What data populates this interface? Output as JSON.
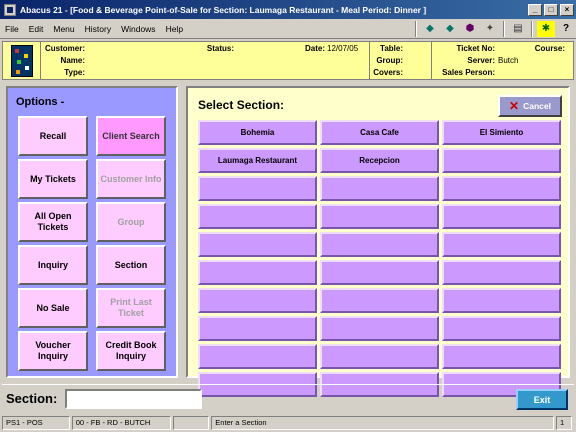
{
  "window": {
    "title": "Abacus 21 - [Food & Beverage Point-of-Sale for Section: Laumaga Restaurant - Meal Period: Dinner ]"
  },
  "menu": [
    "File",
    "Edit",
    "Menu",
    "History",
    "Windows",
    "Help"
  ],
  "toolbar_icons": [
    "arrow-left-icon",
    "arrow-right-icon",
    "gem-icon",
    "run-icon",
    "calculator-icon",
    "exit-person-icon",
    "help-icon"
  ],
  "ticket_info": {
    "customer_label": "Customer:",
    "name_label": "Name:",
    "type_label": "Type:",
    "status_label": "Status:",
    "date_label": "Date:",
    "date_value": "12/07/05",
    "table_label": "Table:",
    "group_label": "Group:",
    "covers_label": "Covers:",
    "ticket_no_label": "Ticket No:",
    "course_label": "Course:",
    "server_label": "Server:",
    "server_value": "Butch",
    "sales_person_label": "Sales Person:"
  },
  "options": {
    "title": "Options -",
    "buttons": [
      {
        "label": "Recall",
        "state": "enabled"
      },
      {
        "label": "Client Search",
        "state": "active"
      },
      {
        "label": "My Tickets",
        "state": "enabled"
      },
      {
        "label": "Customer Info",
        "state": "disabled"
      },
      {
        "label": "All Open Tickets",
        "state": "enabled"
      },
      {
        "label": "Group",
        "state": "disabled"
      },
      {
        "label": "Inquiry",
        "state": "enabled"
      },
      {
        "label": "Section",
        "state": "enabled"
      },
      {
        "label": "No Sale",
        "state": "enabled"
      },
      {
        "label": "Print Last Ticket",
        "state": "disabled"
      },
      {
        "label": "Voucher Inquiry",
        "state": "enabled"
      },
      {
        "label": "Credit Book Inquiry",
        "state": "enabled"
      }
    ]
  },
  "sections": {
    "title": "Select Section:",
    "cancel_label": "Cancel",
    "items": [
      "Bohemia",
      "Casa Cafe",
      "El Simiento",
      "Laumaga Restaurant",
      "Recepcion",
      "",
      "",
      "",
      "",
      "",
      "",
      "",
      "",
      "",
      "",
      "",
      "",
      "",
      "",
      "",
      "",
      "",
      "",
      "",
      "",
      "",
      "",
      "",
      "",
      ""
    ]
  },
  "bottom": {
    "section_label": "Section:",
    "section_value": "",
    "exit_label": "Exit"
  },
  "status": {
    "panel1": "PS1 - POS",
    "panel2": "00 - FB - RD - BUTCH",
    "panel3": "",
    "panel4": "Enter a Section",
    "panel5": "1"
  },
  "colors": {
    "title_bar": "#0a246a",
    "info_bar": "#ffff99",
    "options_panel": "#9999ff",
    "option_button": "#ffccff",
    "section_panel": "#ffffcc",
    "section_button": "#cc99ff",
    "exit_button": "#3399cc"
  }
}
